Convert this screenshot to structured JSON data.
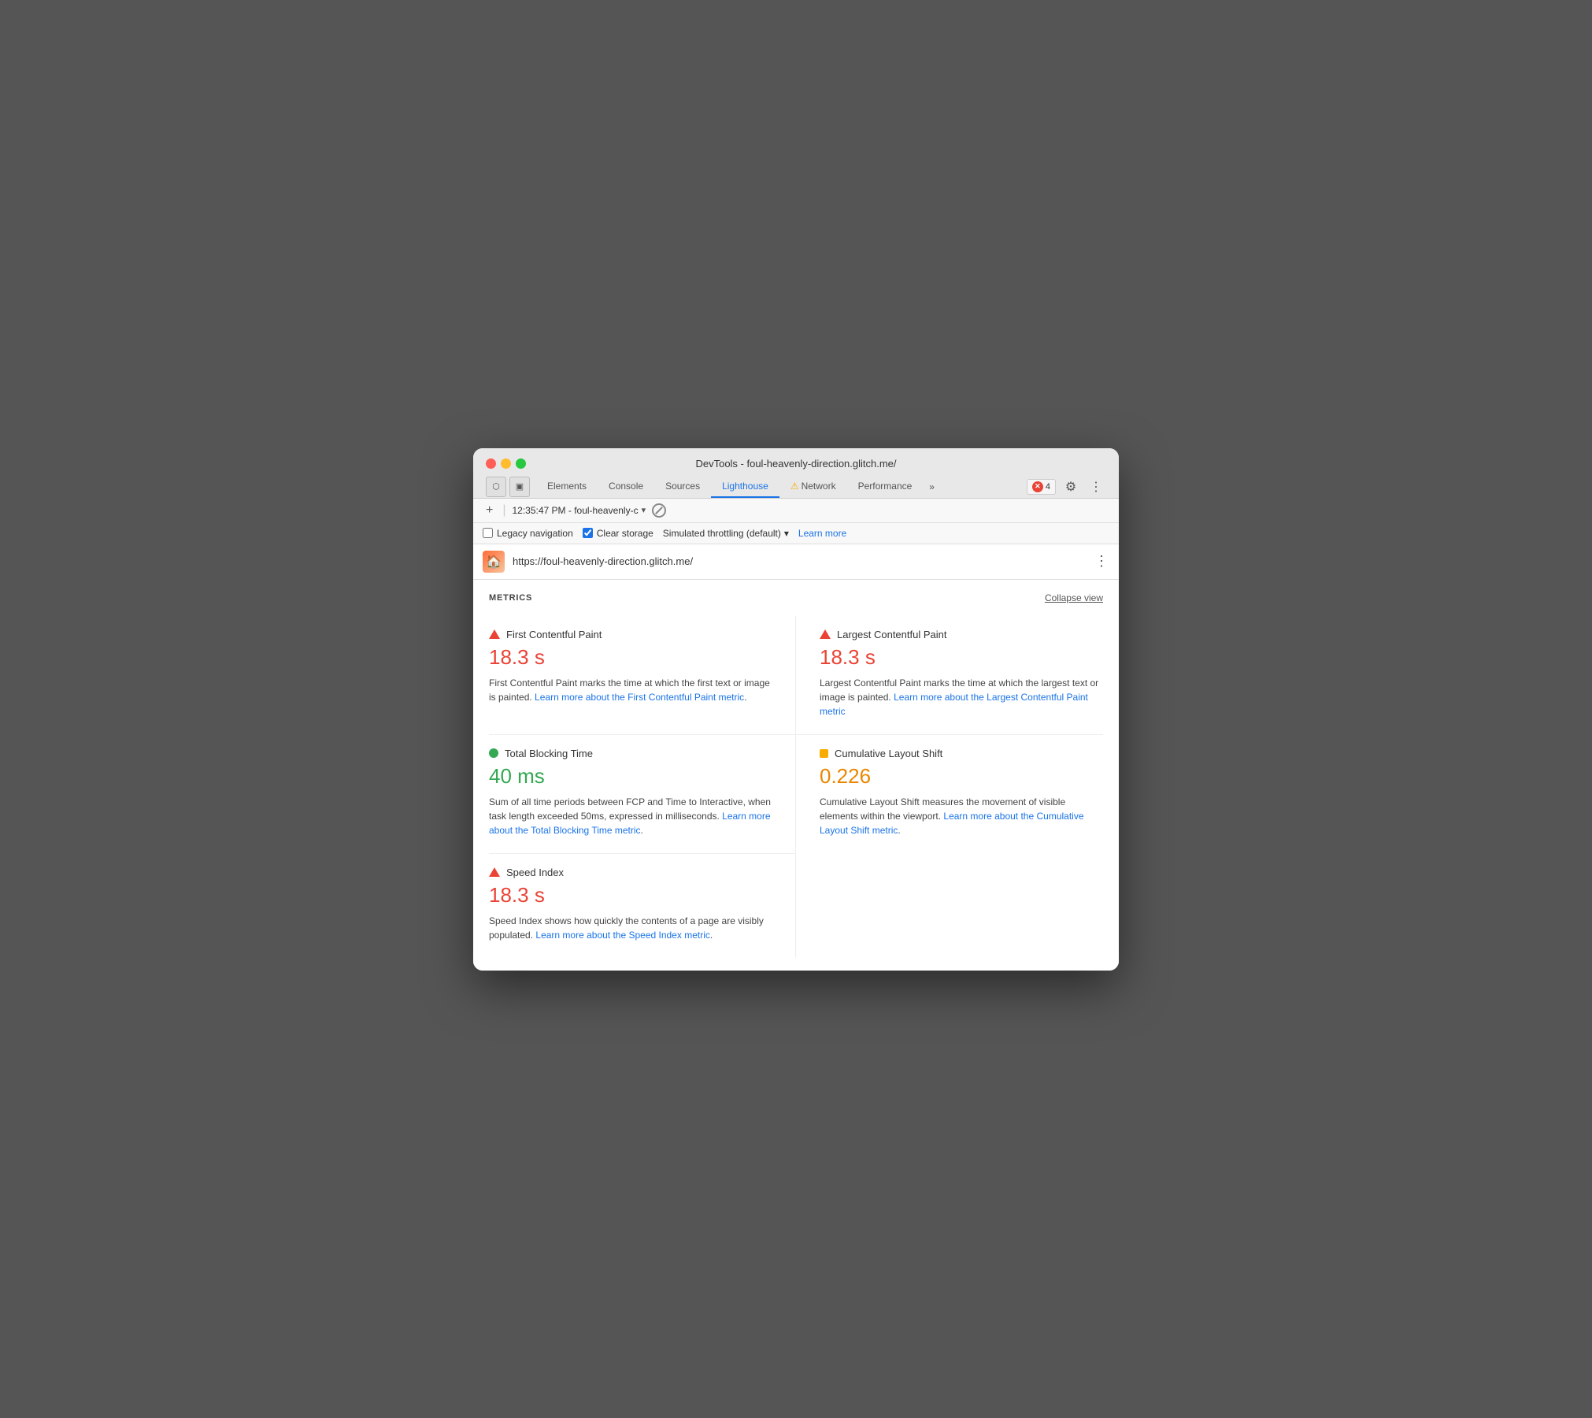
{
  "window": {
    "title": "DevTools - foul-heavenly-direction.glitch.me/"
  },
  "tabs": {
    "items": [
      {
        "id": "elements",
        "label": "Elements",
        "active": false
      },
      {
        "id": "console",
        "label": "Console",
        "active": false
      },
      {
        "id": "sources",
        "label": "Sources",
        "active": false
      },
      {
        "id": "lighthouse",
        "label": "Lighthouse",
        "active": true
      },
      {
        "id": "network",
        "label": "Network",
        "active": false,
        "warning": true
      },
      {
        "id": "performance",
        "label": "Performance",
        "active": false
      }
    ],
    "more_label": "»",
    "error_count": "4"
  },
  "toolbar": {
    "timestamp": "12:35:47 PM - foul-heavenly-c",
    "add_label": "+"
  },
  "options": {
    "legacy_nav_label": "Legacy navigation",
    "legacy_nav_checked": false,
    "clear_storage_label": "Clear storage",
    "clear_storage_checked": true,
    "throttling_label": "Simulated throttling (default)",
    "learn_more_label": "Learn more"
  },
  "url_bar": {
    "url": "https://foul-heavenly-direction.glitch.me/"
  },
  "metrics": {
    "section_label": "METRICS",
    "collapse_label": "Collapse view",
    "items": [
      {
        "id": "fcp",
        "status": "red",
        "name": "First Contentful Paint",
        "value": "18.3 s",
        "color": "red",
        "desc": "First Contentful Paint marks the time at which the first text or image is painted.",
        "link_text": "Learn more about the First Contentful Paint metric",
        "link_url": "#"
      },
      {
        "id": "lcp",
        "status": "red",
        "name": "Largest Contentful Paint",
        "value": "18.3 s",
        "color": "red",
        "desc": "Largest Contentful Paint marks the time at which the largest text or image is painted.",
        "link_text": "Learn more about the Largest Contentful Paint metric",
        "link_url": "#"
      },
      {
        "id": "tbt",
        "status": "green",
        "name": "Total Blocking Time",
        "value": "40 ms",
        "color": "green",
        "desc": "Sum of all time periods between FCP and Time to Interactive, when task length exceeded 50ms, expressed in milliseconds.",
        "link_text": "Learn more about the Total Blocking Time metric",
        "link_url": "#"
      },
      {
        "id": "cls",
        "status": "orange",
        "name": "Cumulative Layout Shift",
        "value": "0.226",
        "color": "orange",
        "desc": "Cumulative Layout Shift measures the movement of visible elements within the viewport.",
        "link_text": "Learn more about the Cumulative Layout Shift metric",
        "link_url": "#"
      },
      {
        "id": "si",
        "status": "red",
        "name": "Speed Index",
        "value": "18.3 s",
        "color": "red",
        "desc": "Speed Index shows how quickly the contents of a page are visibly populated.",
        "link_text": "Learn more about the Speed Index metric",
        "link_url": "#"
      }
    ]
  }
}
